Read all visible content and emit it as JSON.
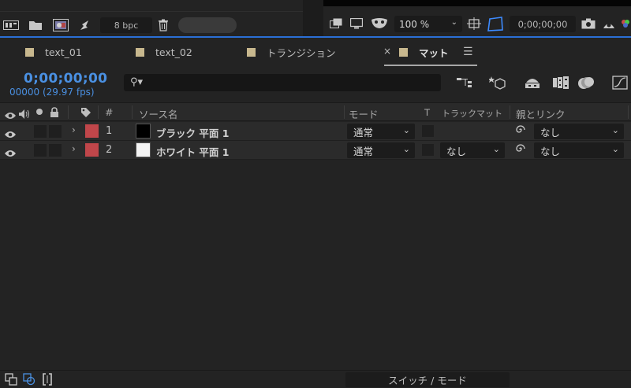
{
  "project_footer": {
    "bpc_label": "8 bpc",
    "icons": [
      "interpret-footage-icon",
      "new-folder-icon",
      "new-composition-icon",
      "flowchart-icon",
      "trash-icon"
    ]
  },
  "viewer_footer": {
    "zoom_value": "100 %",
    "timecode": "0;00;00;00",
    "icons": [
      "always-preview-icon",
      "monitor-icon",
      "mask-visibility-icon",
      "region-of-interest-icon",
      "transparency-grid-icon",
      "camera-snapshot-icon"
    ]
  },
  "tabs": [
    {
      "label": "text_01",
      "active": false
    },
    {
      "label": "text_02",
      "active": false
    },
    {
      "label": "トランジション",
      "active": false
    },
    {
      "label": "マット",
      "active": true
    }
  ],
  "tab_close_glyph": "×",
  "tab_menu_glyph": "☰",
  "timeline": {
    "current_time": "0;00;00;00",
    "frame_fps": "00000 (29.97 fps)",
    "search_placeholder": "",
    "header_icons": [
      "composition-flowchart-icon",
      "draft-3d-icon",
      "hide-shy-layers-icon",
      "frame-blending-icon",
      "motion-blur-icon",
      "graph-editor-icon"
    ]
  },
  "columns": {
    "number": "#",
    "source_name": "ソース名",
    "mode": "モード",
    "t": "T",
    "track_matte": "トラックマット",
    "parent_link": "親とリンク"
  },
  "layers": [
    {
      "num": "1",
      "name": "ブラック 平面 1",
      "mode": "通常",
      "track_matte": "",
      "parent": "なし",
      "thumb_color": "#000000",
      "label_color": "#c0464a"
    },
    {
      "num": "2",
      "name": "ホワイト 平面 1",
      "mode": "通常",
      "track_matte": "なし",
      "parent": "なし",
      "thumb_color": "#f4f4f4",
      "label_color": "#c0464a"
    }
  ],
  "bottom_bar": {
    "switch_label": "スイッチ / モード",
    "icons": [
      "layer-switches-icon",
      "transfer-controls-icon",
      "in-out-duration-icon"
    ]
  },
  "colors": {
    "accent_blue": "#4a90e2",
    "panel_focus_line": "#2b6fd6",
    "label_red": "#c0464a",
    "footage_swatch": "#c8b88e"
  }
}
